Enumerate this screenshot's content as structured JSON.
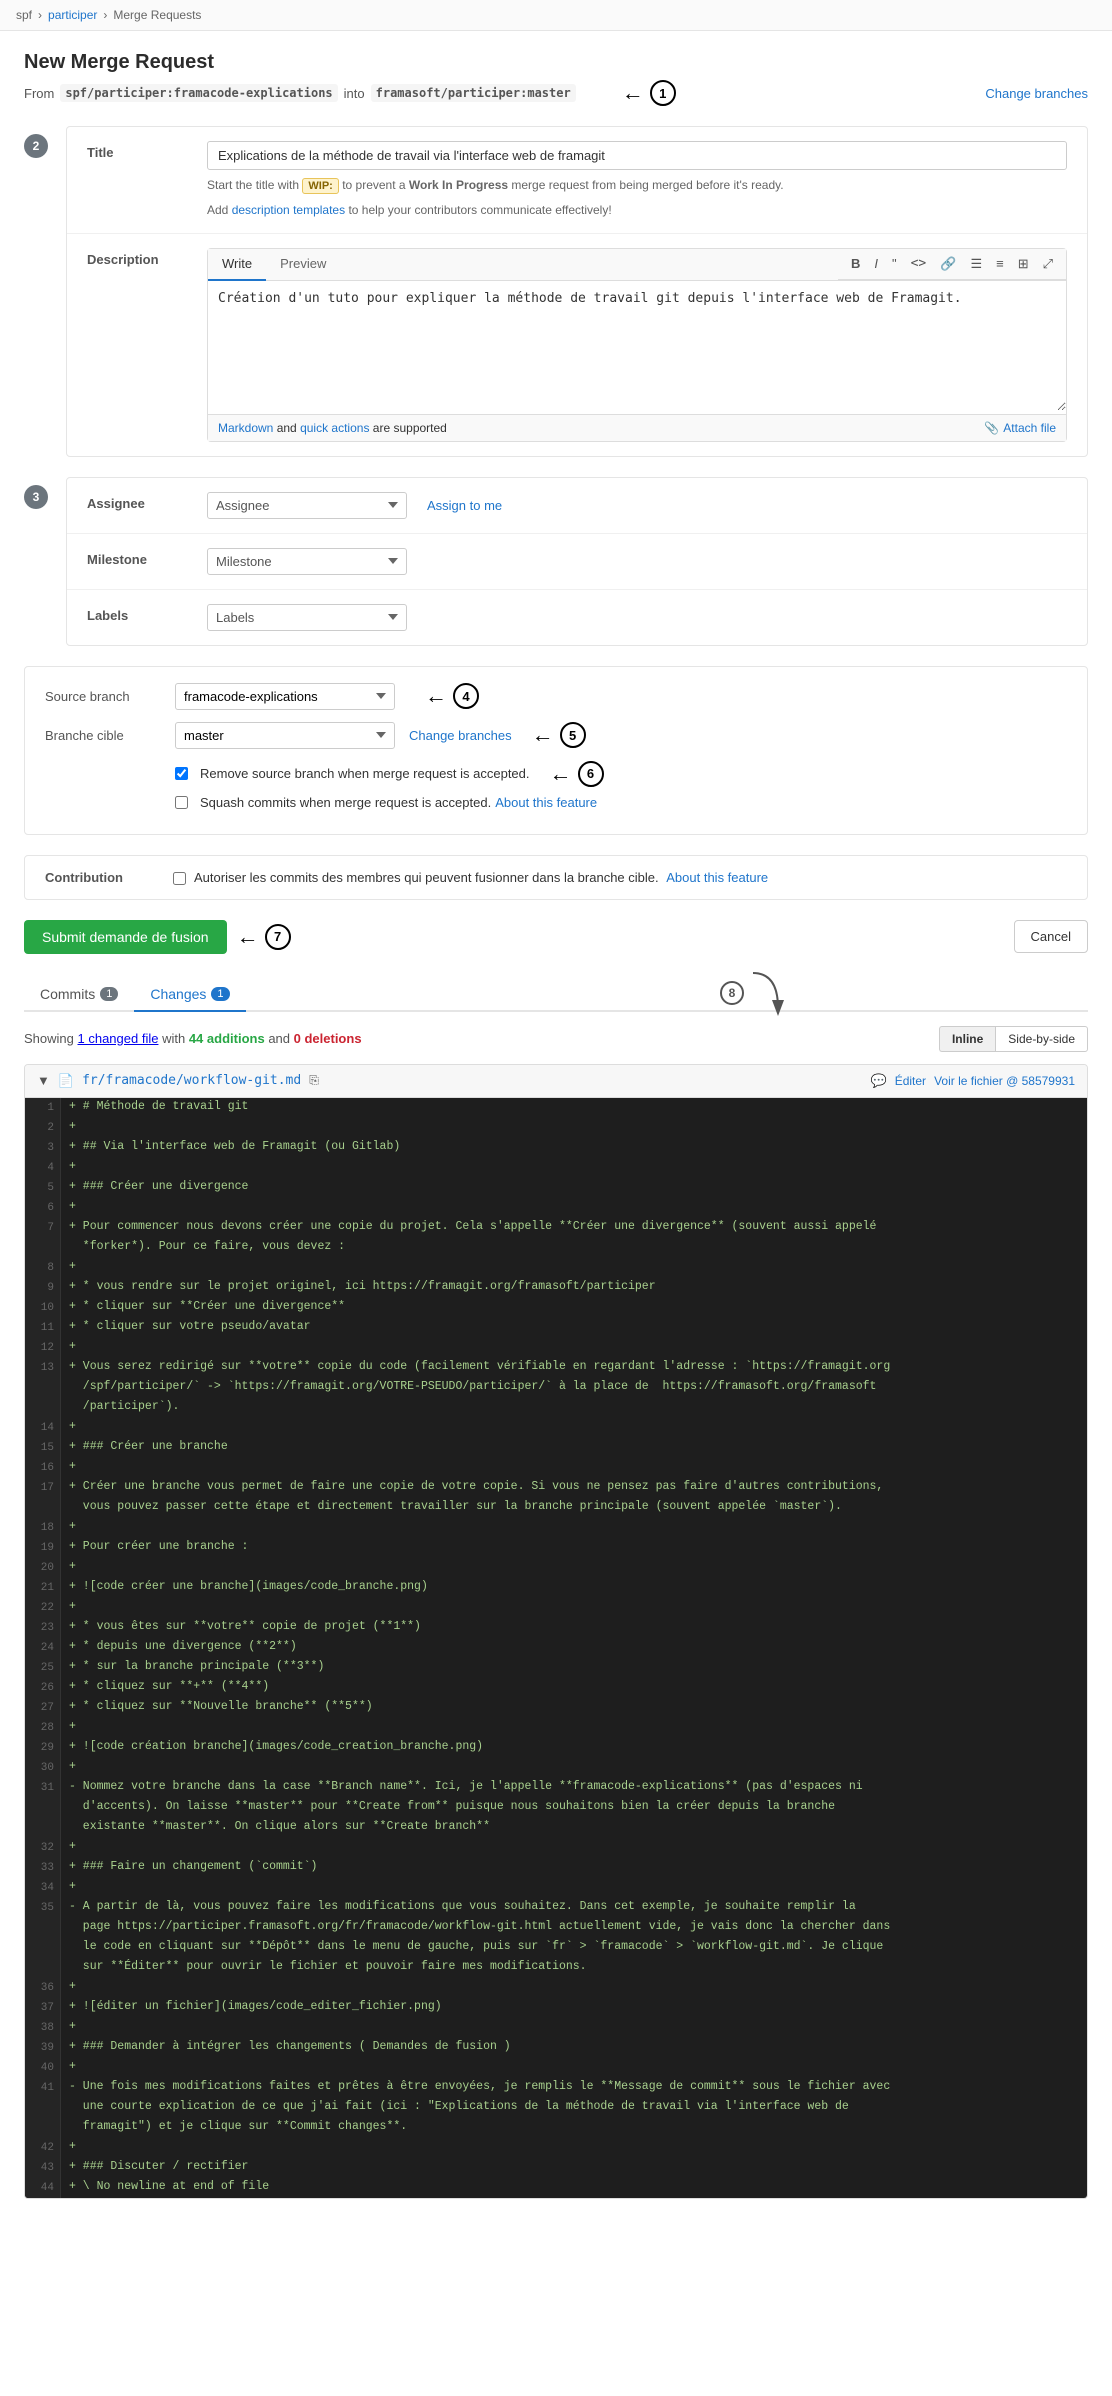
{
  "breadcrumb": {
    "spf": "spf",
    "participer": "participer",
    "page": "Merge Requests"
  },
  "page": {
    "title": "New Merge Request",
    "from_branch": "spf/participer:framacode-explications",
    "into_word": "into",
    "to_branch": "framasoft/participer:master",
    "change_branches": "Change branches"
  },
  "steps": {
    "s2": "2",
    "s3": "3"
  },
  "title_field": {
    "label": "Title",
    "value": "Explications de la méthode de travail via l'interface web de framagit",
    "hint_start": "Start the title with",
    "wip_badge": "WIP:",
    "hint_middle": "to prevent a",
    "hint_bold": "Work In Progress",
    "hint_end": "merge request from being merged before it's ready.",
    "hint2_start": "Add",
    "hint2_link": "description templates",
    "hint2_end": "to help your contributors communicate effectively!"
  },
  "description": {
    "label": "Description",
    "tab_write": "Write",
    "tab_preview": "Preview",
    "toolbar": {
      "bold": "B",
      "italic": "I",
      "quote": "\"",
      "code": "<>",
      "link": "🔗",
      "bullets": "≡",
      "numbered": "≡",
      "table": "⊞",
      "full": "⤢"
    },
    "content": "Création d'un tuto pour expliquer la méthode de travail git depuis l'interface web de Framagit.",
    "footer_start": "Markdown",
    "footer_and": "and",
    "footer_link": "quick actions",
    "footer_end": "are supported",
    "attach_file": "Attach file"
  },
  "assignee": {
    "label": "Assignee",
    "placeholder": "Assignee",
    "assign_to_me": "Assign to me"
  },
  "milestone": {
    "label": "Milestone",
    "placeholder": "Milestone"
  },
  "labels": {
    "label": "Labels",
    "placeholder": "Labels"
  },
  "source_branch": {
    "label": "Source branch",
    "value": "framacode-explications"
  },
  "target_branch": {
    "label": "Branche cible",
    "value": "master",
    "change_link": "Change branches"
  },
  "checkboxes": {
    "remove_source": "Remove source branch when merge request is accepted.",
    "squash": "Squash commits when merge request is accepted.",
    "squash_link": "About this feature"
  },
  "contribution": {
    "label": "Contribution",
    "text": "Autoriser les commits des membres qui peuvent fusionner dans la branche cible.",
    "link": "About this feature"
  },
  "buttons": {
    "submit": "Submit demande de fusion",
    "cancel": "Cancel"
  },
  "tabs": {
    "commits": "Commits",
    "commits_count": "1",
    "changes": "Changes",
    "changes_count": "1"
  },
  "diff": {
    "stats": "Showing",
    "changed_file": "1 changed file",
    "with": "with",
    "additions": "44 additions",
    "and": "and",
    "deletions": "0 deletions",
    "inline": "Inline",
    "side_by_side": "Side-by-side",
    "file_path": "fr/framacode/workflow-git.md",
    "edit": "Éditer",
    "view": "Voir le fichier @ 58579931"
  },
  "code_lines": [
    {
      "num": "1",
      "content": "+ # Méthode de travail git"
    },
    {
      "num": "2",
      "content": "+"
    },
    {
      "num": "3",
      "content": "+ ## Via l'interface web de Framagit (ou Gitlab)"
    },
    {
      "num": "4",
      "content": "+"
    },
    {
      "num": "5",
      "content": "+ ### Créer une divergence"
    },
    {
      "num": "6",
      "content": "+"
    },
    {
      "num": "7",
      "content": "+ Pour commencer nous devons créer une copie du projet. Cela s'appelle **Créer une divergence** (souvent aussi appelé"
    },
    {
      "num": "",
      "content": "  *forker*). Pour ce faire, vous devez :"
    },
    {
      "num": "8",
      "content": "+"
    },
    {
      "num": "9",
      "content": "+ * vous rendre sur le projet originel, ici https://framagit.org/framasoft/participer"
    },
    {
      "num": "10",
      "content": "+ * cliquer sur **Créer une divergence**"
    },
    {
      "num": "11",
      "content": "+ * cliquer sur votre pseudo/avatar"
    },
    {
      "num": "12",
      "content": "+"
    },
    {
      "num": "13",
      "content": "+ Vous serez redirigé sur **votre** copie du code (facilement vérifiable en regardant l'adresse : `https://framagit.org"
    },
    {
      "num": "",
      "content": "  /spf/participer/` -> `https://framagit.org/VOTRE-PSEUDO/participer/` à la place de  https://framasoft.org/framasoft"
    },
    {
      "num": "",
      "content": "  /participer`)."
    },
    {
      "num": "14",
      "content": "+"
    },
    {
      "num": "15",
      "content": "+ ### Créer une branche"
    },
    {
      "num": "16",
      "content": "+"
    },
    {
      "num": "17",
      "content": "+ Créer une branche vous permet de faire une copie de votre copie. Si vous ne pensez pas faire d'autres contributions,"
    },
    {
      "num": "",
      "content": "  vous pouvez passer cette étape et directement travailler sur la branche principale (souvent appelée `master`)."
    },
    {
      "num": "18",
      "content": "+"
    },
    {
      "num": "19",
      "content": "+ Pour créer une branche :"
    },
    {
      "num": "20",
      "content": "+"
    },
    {
      "num": "21",
      "content": "+ ![code créer une branche](images/code_branche.png)"
    },
    {
      "num": "22",
      "content": "+"
    },
    {
      "num": "23",
      "content": "+ * vous êtes sur **votre** copie de projet (**1**)"
    },
    {
      "num": "24",
      "content": "+ * depuis une divergence (**2**)"
    },
    {
      "num": "25",
      "content": "+ * sur la branche principale (**3**)"
    },
    {
      "num": "26",
      "content": "+ * cliquez sur **+** (**4**)"
    },
    {
      "num": "27",
      "content": "+ * cliquez sur **Nouvelle branche** (**5**)"
    },
    {
      "num": "28",
      "content": "+"
    },
    {
      "num": "29",
      "content": "+ ![code création branche](images/code_creation_branche.png)"
    },
    {
      "num": "30",
      "content": "+"
    },
    {
      "num": "31",
      "content": "- Nommez votre branche dans la case **Branch name**. Ici, je l'appelle **framacode-explications** (pas d'espaces ni"
    },
    {
      "num": "",
      "content": "  d'accents). On laisse **master** pour **Create from** puisque nous souhaitons bien la créer depuis la branche"
    },
    {
      "num": "",
      "content": "  existante **master**. On clique alors sur **Create branch**"
    },
    {
      "num": "32",
      "content": "+"
    },
    {
      "num": "33",
      "content": "+ ### Faire un changement (`commit`)"
    },
    {
      "num": "34",
      "content": "+"
    },
    {
      "num": "35",
      "content": "- A partir de là, vous pouvez faire les modifications que vous souhaitez. Dans cet exemple, je souhaite remplir la"
    },
    {
      "num": "",
      "content": "  page https://participer.framasoft.org/fr/framacode/workflow-git.html actuellement vide, je vais donc la chercher dans"
    },
    {
      "num": "",
      "content": "  le code en cliquant sur **Dépôt** dans le menu de gauche, puis sur `fr` > `framacode` > `workflow-git.md`. Je clique"
    },
    {
      "num": "",
      "content": "  sur **Éditer** pour ouvrir le fichier et pouvoir faire mes modifications."
    },
    {
      "num": "36",
      "content": "+"
    },
    {
      "num": "37",
      "content": "+ ![éditer un fichier](images/code_editer_fichier.png)"
    },
    {
      "num": "38",
      "content": "+"
    },
    {
      "num": "39",
      "content": "+ ### Demander à intégrer les changements ( Demandes de fusion )"
    },
    {
      "num": "40",
      "content": "+"
    },
    {
      "num": "41",
      "content": "- Une fois mes modifications faites et prêtes à être envoyées, je remplis le **Message de commit** sous le fichier avec"
    },
    {
      "num": "",
      "content": "  une courte explication de ce que j'ai fait (ici : \"Explications de la méthode de travail via l'interface web de"
    },
    {
      "num": "",
      "content": "  framagit\") et je clique sur **Commit changes**."
    },
    {
      "num": "42",
      "content": "+"
    },
    {
      "num": "43",
      "content": "+ ### Discuter / rectifier"
    },
    {
      "num": "44",
      "content": "+ \\ No newline at end of file"
    }
  ]
}
